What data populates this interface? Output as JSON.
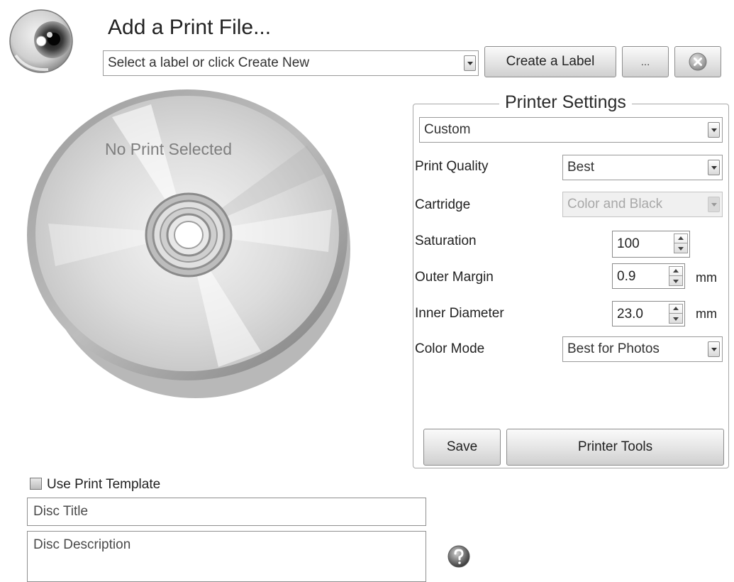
{
  "header": {
    "title": "Add a Print File...",
    "label_select": {
      "value": "Select a label or click Create New"
    },
    "create_label_button": "Create a Label",
    "more_button": "..."
  },
  "preview": {
    "status_text": "No Print Selected"
  },
  "printer_settings": {
    "title": "Printer Settings",
    "profile": {
      "value": "Custom"
    },
    "print_quality": {
      "label": "Print Quality",
      "value": "Best"
    },
    "cartridge": {
      "label": "Cartridge",
      "value": "Color and Black"
    },
    "saturation": {
      "label": "Saturation",
      "value": "100"
    },
    "outer_margin": {
      "label": "Outer Margin",
      "value": "0.9",
      "unit": "mm"
    },
    "inner_diameter": {
      "label": "Inner Diameter",
      "value": "23.0",
      "unit": "mm"
    },
    "color_mode": {
      "label": "Color Mode",
      "value": "Best for Photos"
    },
    "save_button": "Save",
    "printer_tools_button": "Printer Tools"
  },
  "template": {
    "use_template_label": "Use Print Template",
    "use_template_checked": false,
    "disc_title_placeholder": "Disc Title",
    "disc_description_placeholder": "Disc Description"
  },
  "icons": {
    "app": "disc-eye-icon",
    "close": "close-icon",
    "help": "help-icon"
  },
  "colors": {
    "background": "#ffffff",
    "disabled_text": "#a8a8a8"
  }
}
